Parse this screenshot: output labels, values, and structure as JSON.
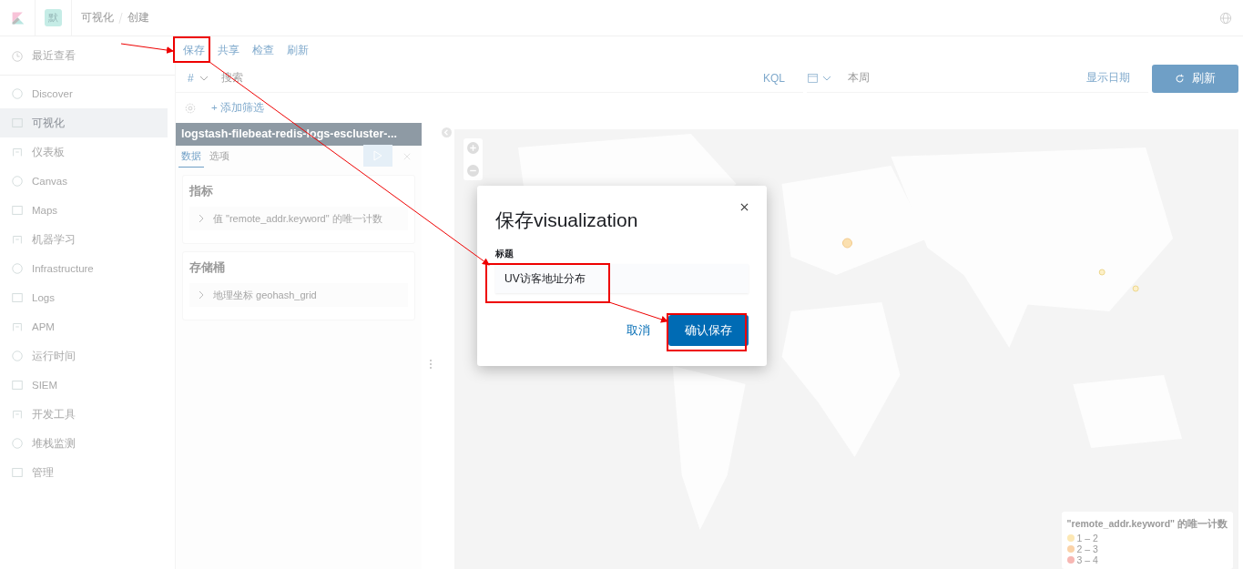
{
  "header": {
    "space_badge": "默",
    "breadcrumbs": [
      "可视化",
      "创建"
    ]
  },
  "sidebar": {
    "recent": "最近查看",
    "items": [
      {
        "label": "Discover",
        "selected": false
      },
      {
        "label": "可视化",
        "selected": true
      },
      {
        "label": "仪表板",
        "selected": false
      },
      {
        "label": "Canvas",
        "selected": false
      },
      {
        "label": "Maps",
        "selected": false
      },
      {
        "label": "机器学习",
        "selected": false
      },
      {
        "label": "Infrastructure",
        "selected": false
      },
      {
        "label": "Logs",
        "selected": false
      },
      {
        "label": "APM",
        "selected": false
      },
      {
        "label": "运行时间",
        "selected": false
      },
      {
        "label": "SIEM",
        "selected": false
      },
      {
        "label": "开发工具",
        "selected": false
      },
      {
        "label": "堆栈监测",
        "selected": false
      },
      {
        "label": "管理",
        "selected": false
      }
    ]
  },
  "top_nav": [
    "保存",
    "共享",
    "检查",
    "刷新"
  ],
  "query_bar": {
    "field_type": "#",
    "placeholder": "搜索",
    "language": "KQL",
    "date_range": "本周",
    "show_dates": "显示日期",
    "refresh_button": "刷新"
  },
  "filter_bar": {
    "add_filter": "+ 添加筛选"
  },
  "editor": {
    "index_title": "logstash-filebeat-redis-logs-escluster-...",
    "tabs": [
      {
        "label": "数据",
        "selected": true
      },
      {
        "label": "选项",
        "selected": false
      }
    ],
    "sections": [
      {
        "title": "指标",
        "items": [
          "值 \"remote_addr.keyword\" 的唯一计数"
        ]
      },
      {
        "title": "存储桶",
        "items": [
          "地理坐标 geohash_grid"
        ]
      }
    ]
  },
  "map": {
    "legend": {
      "title": "\"remote_addr.keyword\" 的唯一计数",
      "items": [
        {
          "label": "1 – 2",
          "color": "#fde8b4"
        },
        {
          "label": "2 – 3",
          "color": "#fbd3a8"
        },
        {
          "label": "3 – 4",
          "color": "#f7b7b3"
        }
      ]
    }
  },
  "modal": {
    "title": "保存visualization",
    "field_label": "标题",
    "value": "UV访客地址分布",
    "cancel": "取消",
    "confirm": "确认保存"
  }
}
